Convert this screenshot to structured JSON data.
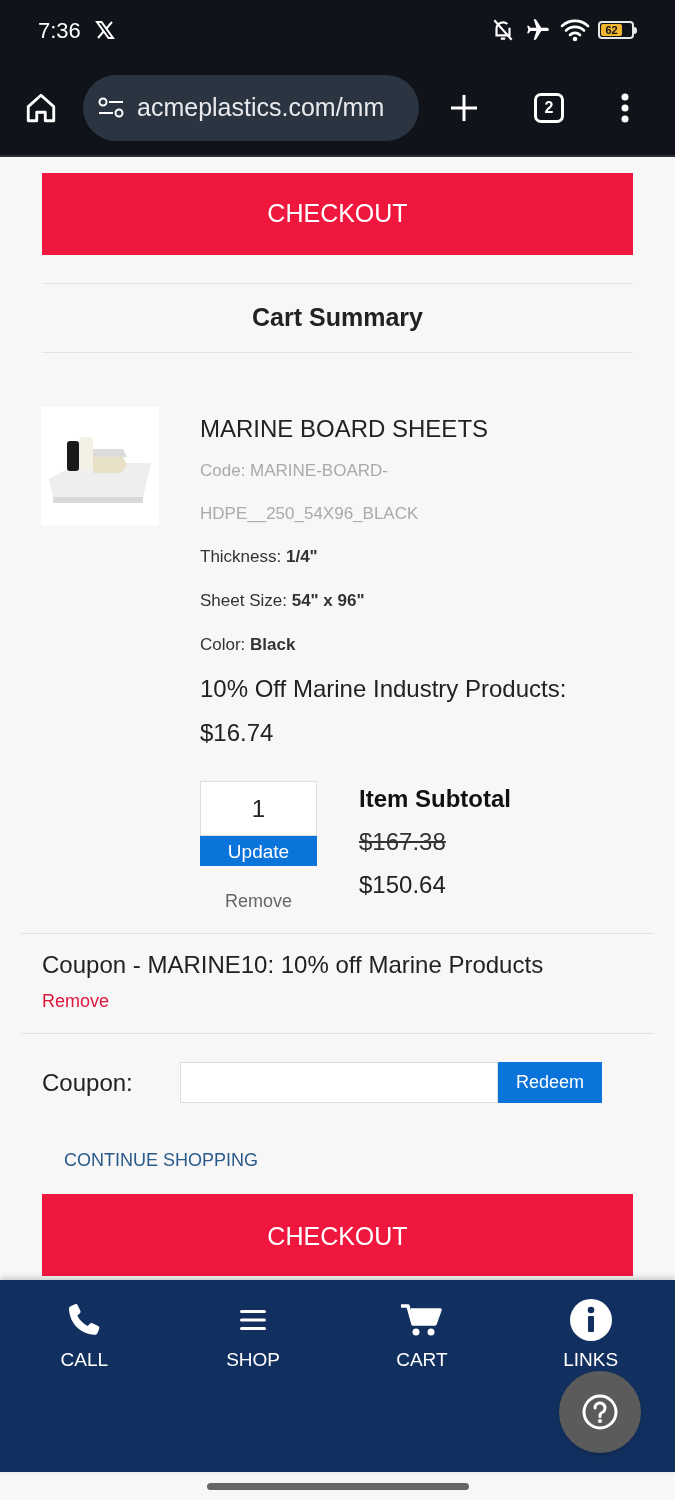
{
  "status_bar": {
    "time": "7:36",
    "battery": "62"
  },
  "browser": {
    "url": "acmeplastics.com/mm",
    "tab_count": "2"
  },
  "top_checkout": "CHECKOUT",
  "cart_summary_title": "Cart Summary",
  "item": {
    "name": "MARINE BOARD SHEETS",
    "code": "Code: MARINE-BOARD-HDPE__250_54X96_BLACK",
    "options": [
      {
        "label": "Thickness:",
        "value": "1/4\""
      },
      {
        "label": "Sheet Size:",
        "value": "54\" x 96\""
      },
      {
        "label": "Color:",
        "value": "Black"
      }
    ],
    "discount_label": "10% Off Marine Industry Products:",
    "unit_price": "$16.74",
    "quantity": "1",
    "update": "Update",
    "remove": "Remove",
    "subtotal_label": "Item Subtotal",
    "original_price": "$167.38",
    "subtotal": "$150.64"
  },
  "applied_coupon": {
    "text": "Coupon - MARINE10: 10% off Marine Products",
    "remove": "Remove"
  },
  "coupon_form": {
    "label": "Coupon:",
    "button": "Redeem"
  },
  "continue_shopping": "CONTINUE SHOPPING",
  "bottom_checkout": "CHECKOUT",
  "bottom_nav": [
    {
      "label": "CALL",
      "kind": "phone"
    },
    {
      "label": "SHOP",
      "kind": "menu"
    },
    {
      "label": "CART",
      "kind": "cart"
    },
    {
      "label": "LINKS",
      "kind": "info"
    }
  ]
}
